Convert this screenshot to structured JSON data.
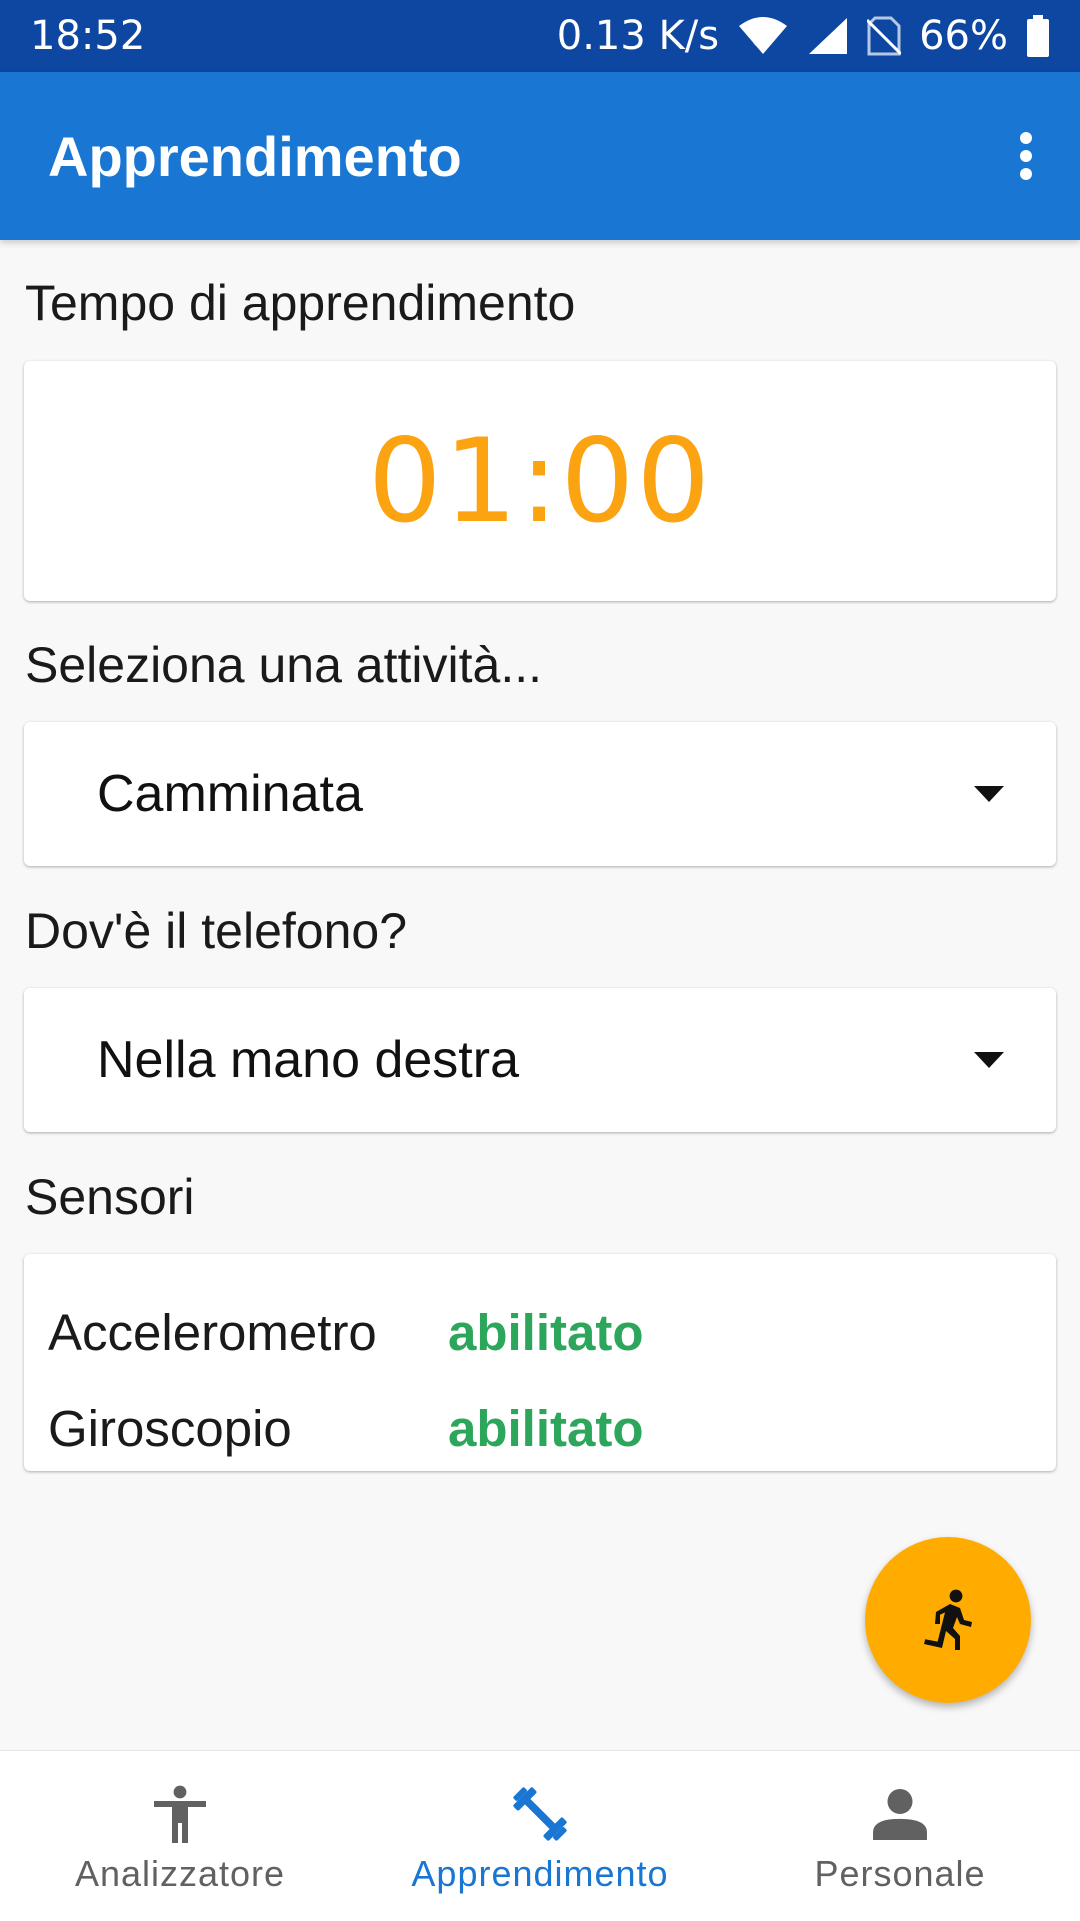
{
  "status_bar": {
    "time": "18:52",
    "network_speed": "0.13 K/s",
    "battery": "66%",
    "icons": [
      "wifi-icon",
      "signal-icon",
      "no-sim-icon",
      "battery-icon"
    ]
  },
  "app_bar": {
    "title": "Apprendimento",
    "overflow_icon": "more-vert-icon"
  },
  "timer": {
    "label": "Tempo di apprendimento",
    "value": "01:00"
  },
  "activity": {
    "label": "Seleziona una attività...",
    "selected": "Camminata"
  },
  "phone_position": {
    "label": "Dov'è il telefono?",
    "selected": "Nella mano destra"
  },
  "sensors": {
    "label": "Sensori",
    "items": [
      {
        "name": "Accelerometro",
        "status": "abilitato"
      },
      {
        "name": "Giroscopio",
        "status": "abilitato"
      }
    ]
  },
  "fab": {
    "icon": "run-icon"
  },
  "bottom_nav": {
    "items": [
      {
        "label": "Analizzatore",
        "icon": "accessibility-icon",
        "active": false
      },
      {
        "label": "Apprendimento",
        "icon": "fitness-icon",
        "active": true
      },
      {
        "label": "Personale",
        "icon": "person-icon",
        "active": false
      }
    ]
  },
  "colors": {
    "status_bar": "#0d47a1",
    "app_bar": "#1976d2",
    "timer": "#fca311",
    "enabled": "#2ba65a",
    "fab": "#ffab00",
    "nav_active": "#1976d2",
    "nav_inactive": "#616161"
  }
}
